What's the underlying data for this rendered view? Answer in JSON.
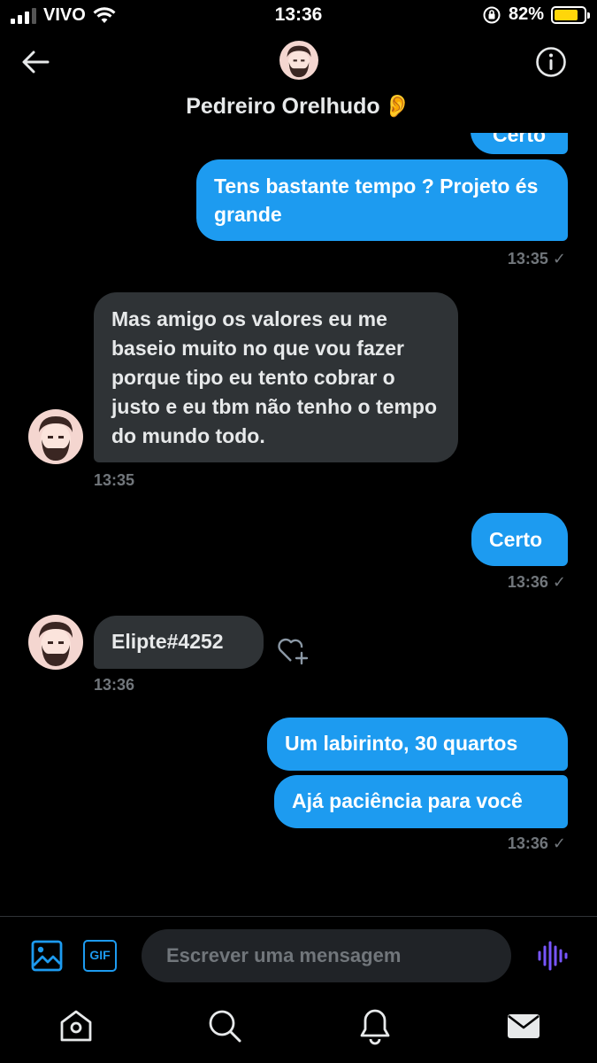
{
  "status_bar": {
    "carrier": "VIVO",
    "time": "13:36",
    "battery_percent": "82%",
    "battery_level": 0.82
  },
  "header": {
    "contact_name": "Pedreiro Orelhudo",
    "name_emoji": "👂",
    "back_icon": "back-arrow-icon",
    "info_icon": "info-icon"
  },
  "messages": [
    {
      "direction": "out",
      "text": "Tens bastante tempo ? Projeto és grande",
      "time": "13:35",
      "read_mark": "✓"
    },
    {
      "direction": "in",
      "text": "Mas amigo os valores eu me baseio muito no que vou fazer porque tipo eu tento cobrar o justo e eu tbm não tenho o tempo do mundo todo.",
      "time": "13:35"
    },
    {
      "direction": "out",
      "text": "Certo",
      "time": "13:36",
      "read_mark": "✓"
    },
    {
      "direction": "in",
      "text": "Elipte#4252",
      "time": "13:36"
    },
    {
      "direction": "out",
      "text": "Um labirinto, 30 quartos"
    },
    {
      "direction": "out",
      "text": "Ajá paciência para você",
      "time": "13:36",
      "read_mark": "✓"
    }
  ],
  "partial_top_message": "Certo",
  "composer": {
    "placeholder": "Escrever uma mensagem",
    "value": "",
    "icons": [
      "image-icon",
      "gif-icon",
      "voice-message-icon"
    ],
    "gif_label": "GIF"
  },
  "tab_bar": {
    "icons": [
      "home-icon",
      "search-icon",
      "notifications-icon",
      "messages-icon"
    ]
  },
  "colors": {
    "accent": "#1d9bf0",
    "incoming_bubble": "#2f3336",
    "background": "#000000",
    "muted_text": "#71767b",
    "voice_icon": "#7856ff"
  }
}
